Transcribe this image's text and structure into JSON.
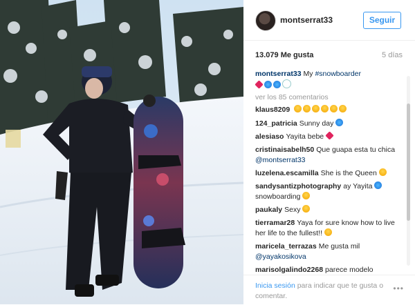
{
  "post": {
    "username": "montserrat33",
    "follow_label": "Seguir",
    "likes": "13.079 Me gusta",
    "time": "5 días"
  },
  "comments": [
    {
      "user": "montserrat33",
      "text": "My ",
      "tag": "#snowboarder"
    },
    {
      "view_more": "ver los 85 comentarios"
    },
    {
      "user": "klaus8209",
      "text": ""
    },
    {
      "user": "124_patricia",
      "text": "Sunny day"
    },
    {
      "user": "alesiaso",
      "text": "Yayita bebe"
    },
    {
      "user": "cristinaisabelh50",
      "text": "Que guapa esta tu chica ",
      "mention": "@montserrat33"
    },
    {
      "user": "luzelena.escamilla",
      "text": "She is the Queen"
    },
    {
      "user": "sandysantizphotography",
      "text": "ay Yayita",
      "text2": "snowboarding"
    },
    {
      "user": "paukaly",
      "text": "Sexy"
    },
    {
      "user": "tierramar28",
      "text": "Yaya for sure know how to live her life to the fullest!!"
    },
    {
      "user": "maricela_terrazas",
      "text": "Me gusta mil",
      "mention": "@yayakosikova"
    },
    {
      "user": "marisolgalindo2268",
      "text": "parece modelo"
    }
  ],
  "footer": {
    "login_link": "Inicia sesión",
    "login_text": " para indicar que te gusta o comentar.",
    "more_options": "•••"
  },
  "colors": {
    "accent": "#3897f0",
    "link": "#003569",
    "muted": "#999999"
  }
}
